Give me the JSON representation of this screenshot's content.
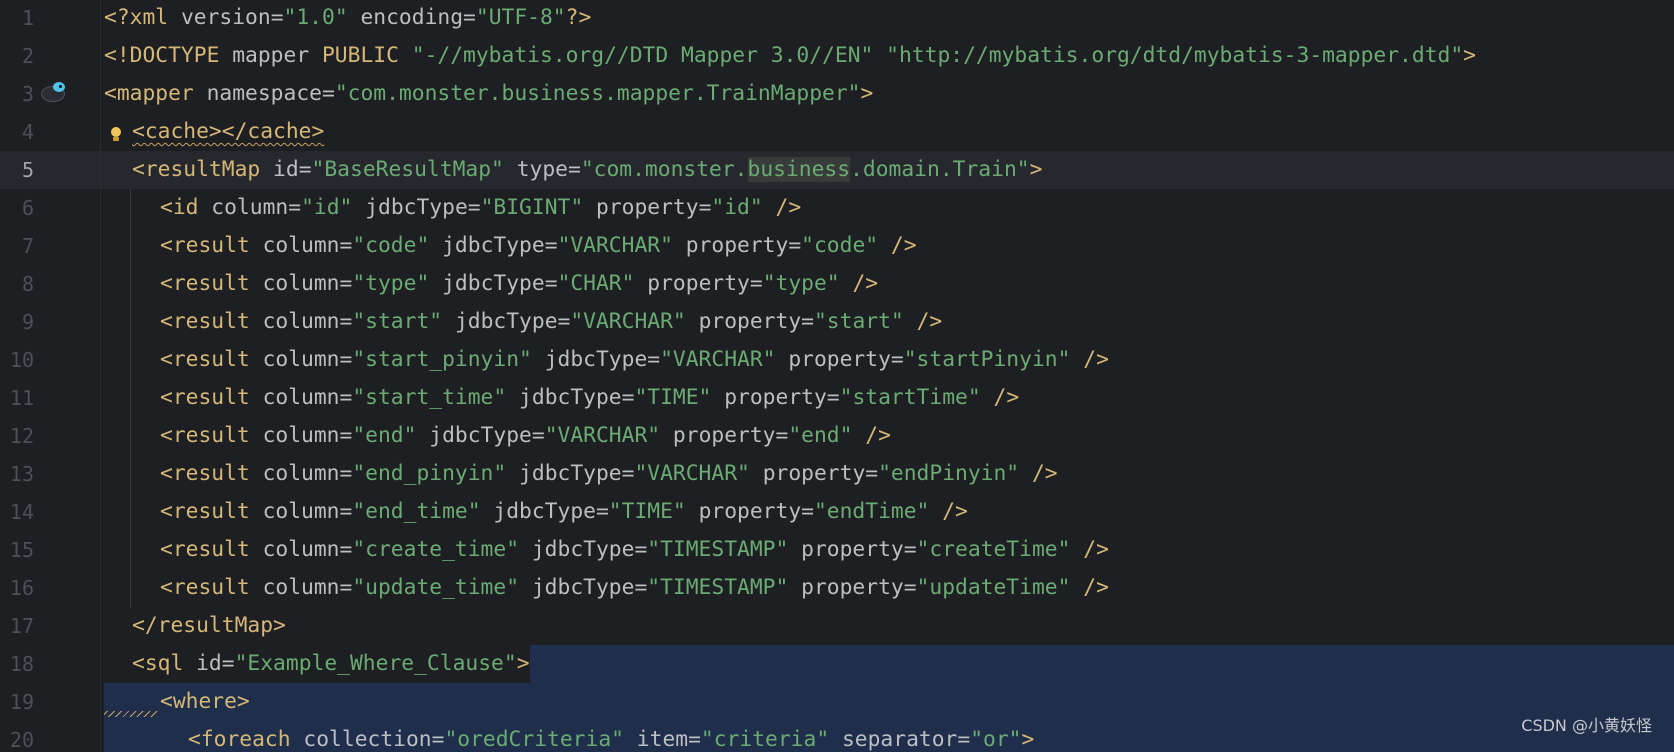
{
  "editor": {
    "watermark": "CSDN @小黄妖怪",
    "caret_line": 5,
    "lines": [
      {
        "n": "1",
        "indent": 0,
        "tokens": [
          [
            "tg",
            "<?xml "
          ],
          [
            "at",
            "version"
          ],
          [
            "ch",
            "="
          ],
          [
            "st",
            "\"1.0\""
          ],
          [
            "ch",
            " "
          ],
          [
            "at",
            "encoding"
          ],
          [
            "ch",
            "="
          ],
          [
            "st",
            "\"UTF-8\""
          ],
          [
            "tg",
            "?>"
          ]
        ]
      },
      {
        "n": "2",
        "indent": 0,
        "tokens": [
          [
            "tg",
            "<!DOCTYPE "
          ],
          [
            "ch",
            "mapper "
          ],
          [
            "tg",
            "PUBLIC "
          ],
          [
            "st",
            "\"-//mybatis.org//DTD Mapper 3.0//EN\""
          ],
          [
            "ch",
            " "
          ],
          [
            "st",
            "\"http://mybatis.org/dtd/mybatis-3-mapper.dtd\""
          ],
          [
            "tg",
            ">"
          ]
        ]
      },
      {
        "n": "3",
        "indent": 0,
        "tokens": [
          [
            "tg",
            "<mapper "
          ],
          [
            "at",
            "namespace"
          ],
          [
            "ch",
            "="
          ],
          [
            "st",
            "\"com.monster.business.mapper.TrainMapper\""
          ],
          [
            "tg",
            ">"
          ]
        ]
      },
      {
        "n": "4",
        "indent": 1,
        "tokens": [
          [
            "tg wavy",
            "<cache></cache>"
          ]
        ]
      },
      {
        "n": "5",
        "indent": 1,
        "tokens": [
          [
            "tg",
            "<resultMap "
          ],
          [
            "at",
            "id"
          ],
          [
            "ch",
            "="
          ],
          [
            "st",
            "\"BaseResultMap\""
          ],
          [
            "ch",
            " "
          ],
          [
            "at",
            "type"
          ],
          [
            "ch",
            "="
          ],
          [
            "st",
            "\"com.monster."
          ],
          [
            "st hl",
            "business"
          ],
          [
            "st",
            ".domain.Train\""
          ],
          [
            "tg",
            ">"
          ]
        ]
      },
      {
        "n": "6",
        "indent": 2,
        "tokens": [
          [
            "tg",
            "<id "
          ],
          [
            "at",
            "column"
          ],
          [
            "ch",
            "="
          ],
          [
            "st",
            "\"id\""
          ],
          [
            "ch",
            " "
          ],
          [
            "at",
            "jdbcType"
          ],
          [
            "ch",
            "="
          ],
          [
            "st",
            "\"BIGINT\""
          ],
          [
            "ch",
            " "
          ],
          [
            "at",
            "property"
          ],
          [
            "ch",
            "="
          ],
          [
            "st",
            "\"id\""
          ],
          [
            "ch",
            " "
          ],
          [
            "tg",
            "/>"
          ]
        ]
      },
      {
        "n": "7",
        "indent": 2,
        "tokens": [
          [
            "tg",
            "<result "
          ],
          [
            "at",
            "column"
          ],
          [
            "ch",
            "="
          ],
          [
            "st",
            "\"code\""
          ],
          [
            "ch",
            " "
          ],
          [
            "at",
            "jdbcType"
          ],
          [
            "ch",
            "="
          ],
          [
            "st",
            "\"VARCHAR\""
          ],
          [
            "ch",
            " "
          ],
          [
            "at",
            "property"
          ],
          [
            "ch",
            "="
          ],
          [
            "st",
            "\"code\""
          ],
          [
            "ch",
            " "
          ],
          [
            "tg",
            "/>"
          ]
        ]
      },
      {
        "n": "8",
        "indent": 2,
        "tokens": [
          [
            "tg",
            "<result "
          ],
          [
            "at",
            "column"
          ],
          [
            "ch",
            "="
          ],
          [
            "st",
            "\"type\""
          ],
          [
            "ch",
            " "
          ],
          [
            "at",
            "jdbcType"
          ],
          [
            "ch",
            "="
          ],
          [
            "st",
            "\"CHAR\""
          ],
          [
            "ch",
            " "
          ],
          [
            "at",
            "property"
          ],
          [
            "ch",
            "="
          ],
          [
            "st",
            "\"type\""
          ],
          [
            "ch",
            " "
          ],
          [
            "tg",
            "/>"
          ]
        ]
      },
      {
        "n": "9",
        "indent": 2,
        "tokens": [
          [
            "tg",
            "<result "
          ],
          [
            "at",
            "column"
          ],
          [
            "ch",
            "="
          ],
          [
            "st",
            "\"start\""
          ],
          [
            "ch",
            " "
          ],
          [
            "at",
            "jdbcType"
          ],
          [
            "ch",
            "="
          ],
          [
            "st",
            "\"VARCHAR\""
          ],
          [
            "ch",
            " "
          ],
          [
            "at",
            "property"
          ],
          [
            "ch",
            "="
          ],
          [
            "st",
            "\"start\""
          ],
          [
            "ch",
            " "
          ],
          [
            "tg",
            "/>"
          ]
        ]
      },
      {
        "n": "10",
        "indent": 2,
        "tokens": [
          [
            "tg",
            "<result "
          ],
          [
            "at",
            "column"
          ],
          [
            "ch",
            "="
          ],
          [
            "st",
            "\"start_pinyin\""
          ],
          [
            "ch",
            " "
          ],
          [
            "at",
            "jdbcType"
          ],
          [
            "ch",
            "="
          ],
          [
            "st",
            "\"VARCHAR\""
          ],
          [
            "ch",
            " "
          ],
          [
            "at",
            "property"
          ],
          [
            "ch",
            "="
          ],
          [
            "st",
            "\"startPinyin\""
          ],
          [
            "ch",
            " "
          ],
          [
            "tg",
            "/>"
          ]
        ]
      },
      {
        "n": "11",
        "indent": 2,
        "tokens": [
          [
            "tg",
            "<result "
          ],
          [
            "at",
            "column"
          ],
          [
            "ch",
            "="
          ],
          [
            "st",
            "\"start_time\""
          ],
          [
            "ch",
            " "
          ],
          [
            "at",
            "jdbcType"
          ],
          [
            "ch",
            "="
          ],
          [
            "st",
            "\"TIME\""
          ],
          [
            "ch",
            " "
          ],
          [
            "at",
            "property"
          ],
          [
            "ch",
            "="
          ],
          [
            "st",
            "\"startTime\""
          ],
          [
            "ch",
            " "
          ],
          [
            "tg",
            "/>"
          ]
        ]
      },
      {
        "n": "12",
        "indent": 2,
        "tokens": [
          [
            "tg",
            "<result "
          ],
          [
            "at",
            "column"
          ],
          [
            "ch",
            "="
          ],
          [
            "st",
            "\"end\""
          ],
          [
            "ch",
            " "
          ],
          [
            "at",
            "jdbcType"
          ],
          [
            "ch",
            "="
          ],
          [
            "st",
            "\"VARCHAR\""
          ],
          [
            "ch",
            " "
          ],
          [
            "at",
            "property"
          ],
          [
            "ch",
            "="
          ],
          [
            "st",
            "\"end\""
          ],
          [
            "ch",
            " "
          ],
          [
            "tg",
            "/>"
          ]
        ]
      },
      {
        "n": "13",
        "indent": 2,
        "tokens": [
          [
            "tg",
            "<result "
          ],
          [
            "at",
            "column"
          ],
          [
            "ch",
            "="
          ],
          [
            "st",
            "\"end_pinyin\""
          ],
          [
            "ch",
            " "
          ],
          [
            "at",
            "jdbcType"
          ],
          [
            "ch",
            "="
          ],
          [
            "st",
            "\"VARCHAR\""
          ],
          [
            "ch",
            " "
          ],
          [
            "at",
            "property"
          ],
          [
            "ch",
            "="
          ],
          [
            "st",
            "\"endPinyin\""
          ],
          [
            "ch",
            " "
          ],
          [
            "tg",
            "/>"
          ]
        ]
      },
      {
        "n": "14",
        "indent": 2,
        "tokens": [
          [
            "tg",
            "<result "
          ],
          [
            "at",
            "column"
          ],
          [
            "ch",
            "="
          ],
          [
            "st",
            "\"end_time\""
          ],
          [
            "ch",
            " "
          ],
          [
            "at",
            "jdbcType"
          ],
          [
            "ch",
            "="
          ],
          [
            "st",
            "\"TIME\""
          ],
          [
            "ch",
            " "
          ],
          [
            "at",
            "property"
          ],
          [
            "ch",
            "="
          ],
          [
            "st",
            "\"endTime\""
          ],
          [
            "ch",
            " "
          ],
          [
            "tg",
            "/>"
          ]
        ]
      },
      {
        "n": "15",
        "indent": 2,
        "tokens": [
          [
            "tg",
            "<result "
          ],
          [
            "at",
            "column"
          ],
          [
            "ch",
            "="
          ],
          [
            "st",
            "\"create_time\""
          ],
          [
            "ch",
            " "
          ],
          [
            "at",
            "jdbcType"
          ],
          [
            "ch",
            "="
          ],
          [
            "st",
            "\"TIMESTAMP\""
          ],
          [
            "ch",
            " "
          ],
          [
            "at",
            "property"
          ],
          [
            "ch",
            "="
          ],
          [
            "st",
            "\"createTime\""
          ],
          [
            "ch",
            " "
          ],
          [
            "tg",
            "/>"
          ]
        ]
      },
      {
        "n": "16",
        "indent": 2,
        "tokens": [
          [
            "tg",
            "<result "
          ],
          [
            "at",
            "column"
          ],
          [
            "ch",
            "="
          ],
          [
            "st",
            "\"update_time\""
          ],
          [
            "ch",
            " "
          ],
          [
            "at",
            "jdbcType"
          ],
          [
            "ch",
            "="
          ],
          [
            "st",
            "\"TIMESTAMP\""
          ],
          [
            "ch",
            " "
          ],
          [
            "at",
            "property"
          ],
          [
            "ch",
            "="
          ],
          [
            "st",
            "\"updateTime\""
          ],
          [
            "ch",
            " "
          ],
          [
            "tg",
            "/>"
          ]
        ]
      },
      {
        "n": "17",
        "indent": 1,
        "tokens": [
          [
            "tg",
            "</resultMap>"
          ]
        ]
      },
      {
        "n": "18",
        "indent": 1,
        "selected": true,
        "tokens": [
          [
            "tg",
            "<sql "
          ],
          [
            "at",
            "id"
          ],
          [
            "ch",
            "="
          ],
          [
            "st",
            "\"Example_Where_Clause\""
          ],
          [
            "tg",
            ">"
          ]
        ]
      },
      {
        "n": "19",
        "indent": 2,
        "selected": true,
        "tokens": [
          [
            "tg",
            "<where>"
          ]
        ]
      },
      {
        "n": "20",
        "indent": 3,
        "selected": true,
        "tokens": [
          [
            "tg",
            "<foreach "
          ],
          [
            "at",
            "collection"
          ],
          [
            "ch",
            "="
          ],
          [
            "st",
            "\"oredCriteria\""
          ],
          [
            "ch",
            " "
          ],
          [
            "at",
            "item"
          ],
          [
            "ch",
            "="
          ],
          [
            "st",
            "\"criteria\""
          ],
          [
            "ch",
            " "
          ],
          [
            "at",
            "separator"
          ],
          [
            "ch",
            "="
          ],
          [
            "st",
            "\"or\""
          ],
          [
            "tg",
            ">"
          ]
        ]
      }
    ]
  }
}
